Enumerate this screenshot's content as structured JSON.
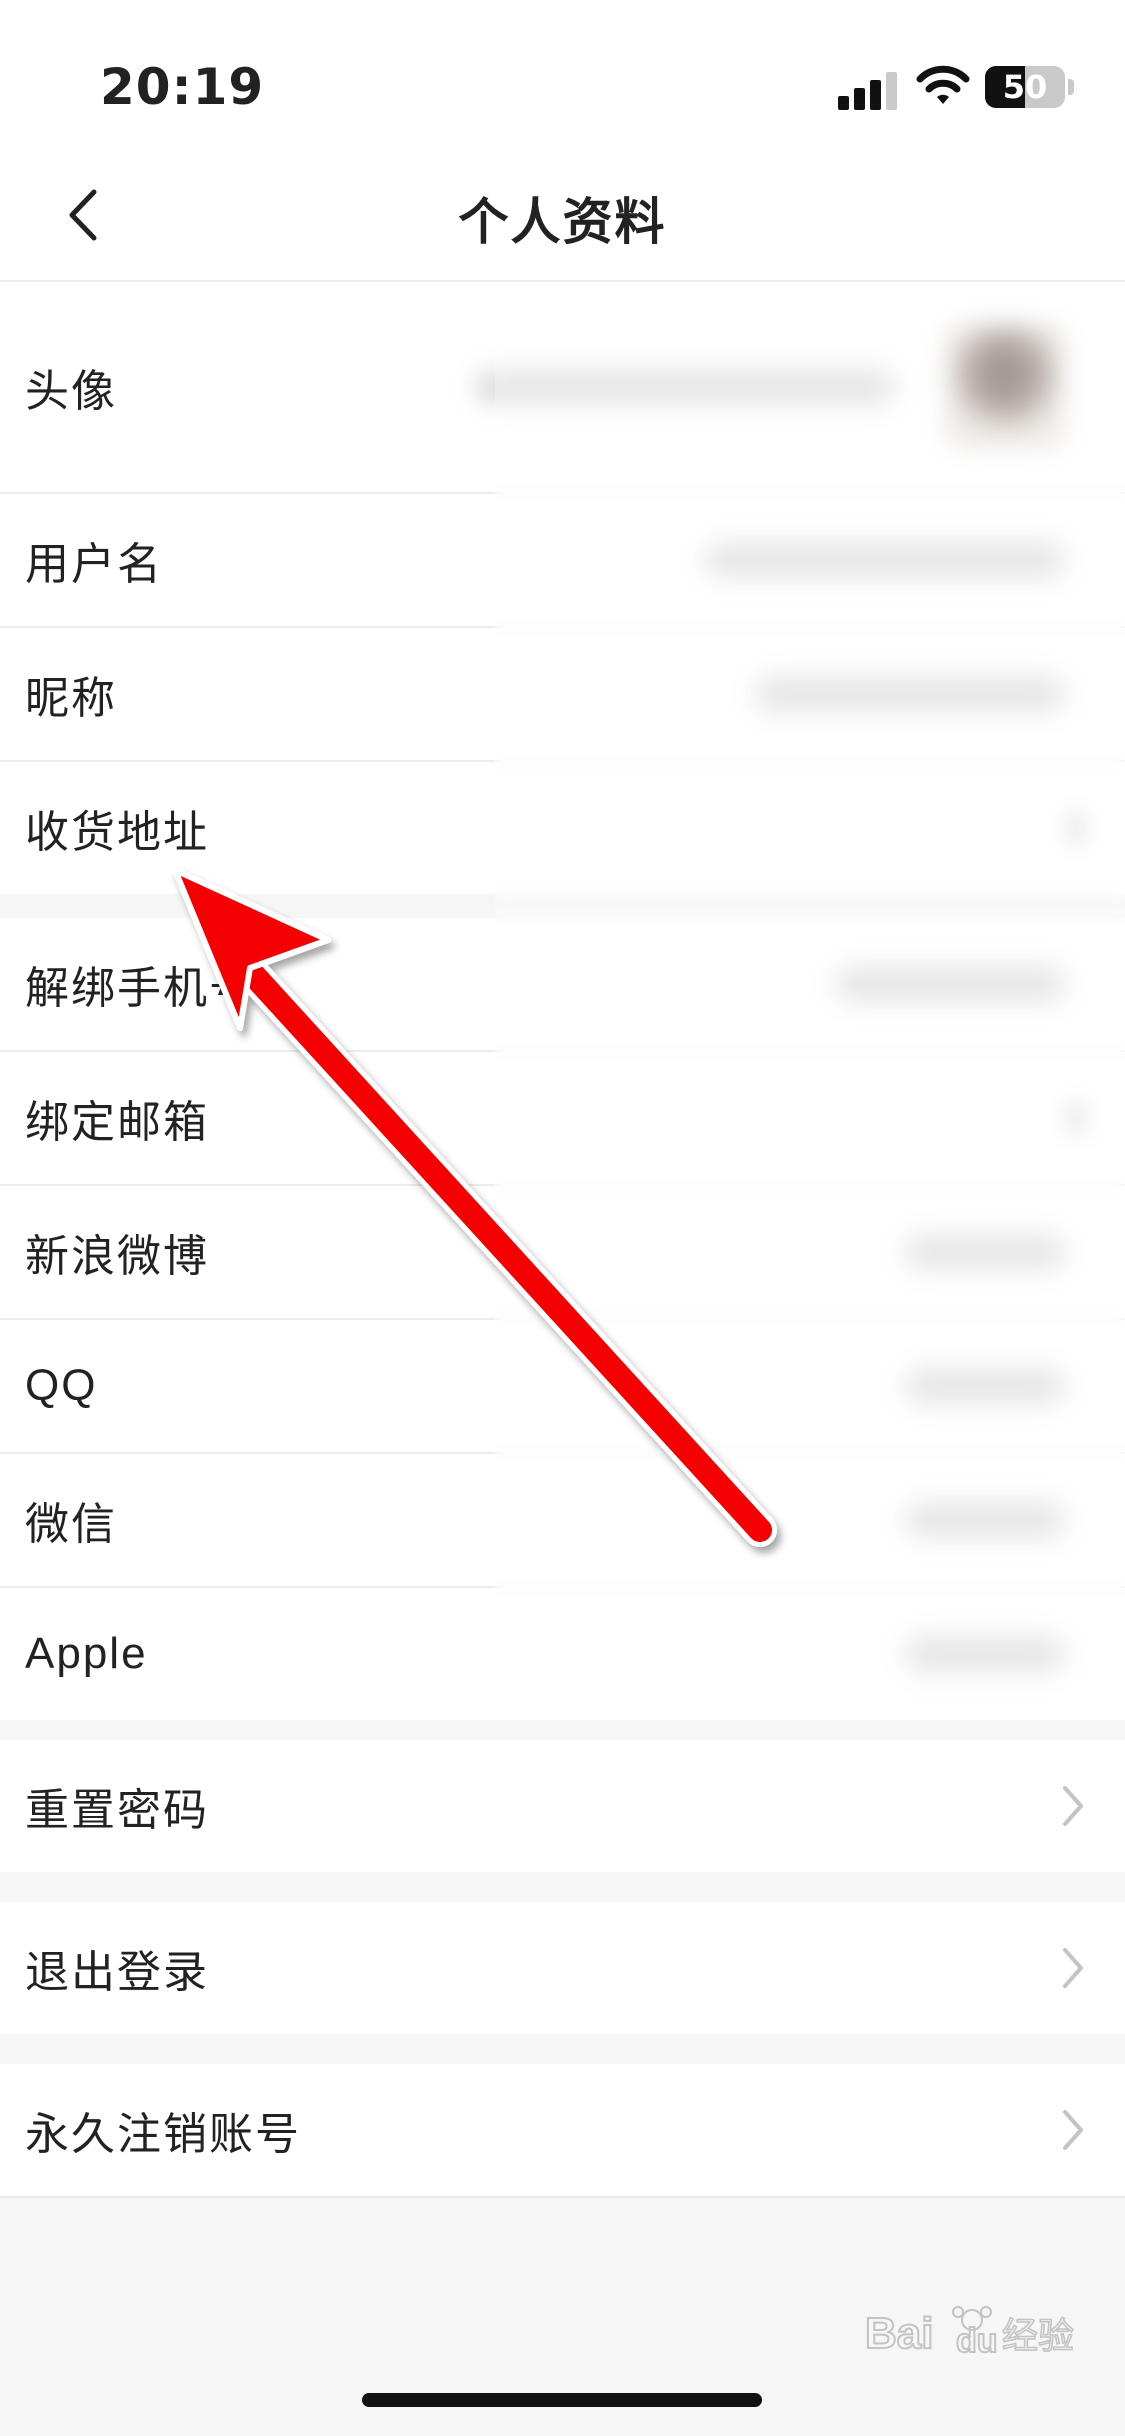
{
  "status_bar": {
    "time": "20:19",
    "battery": "50",
    "battery_level_percent": 50,
    "icons": [
      "signal-icon",
      "wifi-icon",
      "battery-icon"
    ]
  },
  "nav": {
    "title": "个人资料",
    "back_icon": "chevron-left-icon"
  },
  "profile_group": {
    "avatar_label": "头像",
    "items": [
      {
        "label": "用户名"
      },
      {
        "label": "昵称"
      },
      {
        "label": "收货地址"
      }
    ]
  },
  "binding_group": {
    "items": [
      {
        "label": "解绑手机号"
      },
      {
        "label": "绑定邮箱"
      },
      {
        "label": "新浪微博"
      },
      {
        "label": "QQ"
      },
      {
        "label": "微信"
      },
      {
        "label": "Apple"
      }
    ]
  },
  "actions": {
    "reset_password": "重置密码",
    "logout": "退出登录",
    "delete_account": "永久注销账号"
  },
  "watermark": "Baidu 经验",
  "colors": {
    "background": "#f6f6f6",
    "row_background": "#ffffff",
    "divider": "#ececec",
    "annotation_arrow": "#ff0000",
    "chevron": "#c4c4c4"
  }
}
